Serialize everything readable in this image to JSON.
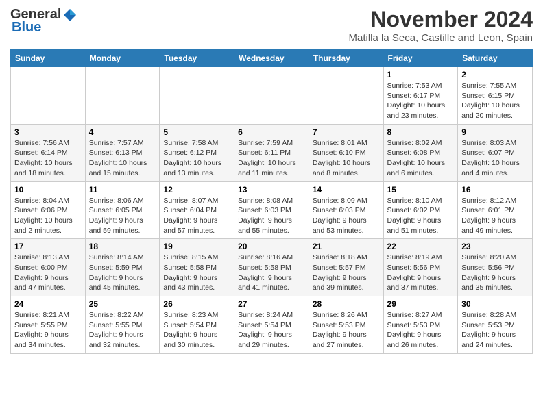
{
  "header": {
    "logo_general": "General",
    "logo_blue": "Blue",
    "month": "November 2024",
    "location": "Matilla la Seca, Castille and Leon, Spain"
  },
  "days_of_week": [
    "Sunday",
    "Monday",
    "Tuesday",
    "Wednesday",
    "Thursday",
    "Friday",
    "Saturday"
  ],
  "weeks": [
    [
      {
        "day": "",
        "info": ""
      },
      {
        "day": "",
        "info": ""
      },
      {
        "day": "",
        "info": ""
      },
      {
        "day": "",
        "info": ""
      },
      {
        "day": "",
        "info": ""
      },
      {
        "day": "1",
        "info": "Sunrise: 7:53 AM\nSunset: 6:17 PM\nDaylight: 10 hours and 23 minutes."
      },
      {
        "day": "2",
        "info": "Sunrise: 7:55 AM\nSunset: 6:15 PM\nDaylight: 10 hours and 20 minutes."
      }
    ],
    [
      {
        "day": "3",
        "info": "Sunrise: 7:56 AM\nSunset: 6:14 PM\nDaylight: 10 hours and 18 minutes."
      },
      {
        "day": "4",
        "info": "Sunrise: 7:57 AM\nSunset: 6:13 PM\nDaylight: 10 hours and 15 minutes."
      },
      {
        "day": "5",
        "info": "Sunrise: 7:58 AM\nSunset: 6:12 PM\nDaylight: 10 hours and 13 minutes."
      },
      {
        "day": "6",
        "info": "Sunrise: 7:59 AM\nSunset: 6:11 PM\nDaylight: 10 hours and 11 minutes."
      },
      {
        "day": "7",
        "info": "Sunrise: 8:01 AM\nSunset: 6:10 PM\nDaylight: 10 hours and 8 minutes."
      },
      {
        "day": "8",
        "info": "Sunrise: 8:02 AM\nSunset: 6:08 PM\nDaylight: 10 hours and 6 minutes."
      },
      {
        "day": "9",
        "info": "Sunrise: 8:03 AM\nSunset: 6:07 PM\nDaylight: 10 hours and 4 minutes."
      }
    ],
    [
      {
        "day": "10",
        "info": "Sunrise: 8:04 AM\nSunset: 6:06 PM\nDaylight: 10 hours and 2 minutes."
      },
      {
        "day": "11",
        "info": "Sunrise: 8:06 AM\nSunset: 6:05 PM\nDaylight: 9 hours and 59 minutes."
      },
      {
        "day": "12",
        "info": "Sunrise: 8:07 AM\nSunset: 6:04 PM\nDaylight: 9 hours and 57 minutes."
      },
      {
        "day": "13",
        "info": "Sunrise: 8:08 AM\nSunset: 6:03 PM\nDaylight: 9 hours and 55 minutes."
      },
      {
        "day": "14",
        "info": "Sunrise: 8:09 AM\nSunset: 6:03 PM\nDaylight: 9 hours and 53 minutes."
      },
      {
        "day": "15",
        "info": "Sunrise: 8:10 AM\nSunset: 6:02 PM\nDaylight: 9 hours and 51 minutes."
      },
      {
        "day": "16",
        "info": "Sunrise: 8:12 AM\nSunset: 6:01 PM\nDaylight: 9 hours and 49 minutes."
      }
    ],
    [
      {
        "day": "17",
        "info": "Sunrise: 8:13 AM\nSunset: 6:00 PM\nDaylight: 9 hours and 47 minutes."
      },
      {
        "day": "18",
        "info": "Sunrise: 8:14 AM\nSunset: 5:59 PM\nDaylight: 9 hours and 45 minutes."
      },
      {
        "day": "19",
        "info": "Sunrise: 8:15 AM\nSunset: 5:58 PM\nDaylight: 9 hours and 43 minutes."
      },
      {
        "day": "20",
        "info": "Sunrise: 8:16 AM\nSunset: 5:58 PM\nDaylight: 9 hours and 41 minutes."
      },
      {
        "day": "21",
        "info": "Sunrise: 8:18 AM\nSunset: 5:57 PM\nDaylight: 9 hours and 39 minutes."
      },
      {
        "day": "22",
        "info": "Sunrise: 8:19 AM\nSunset: 5:56 PM\nDaylight: 9 hours and 37 minutes."
      },
      {
        "day": "23",
        "info": "Sunrise: 8:20 AM\nSunset: 5:56 PM\nDaylight: 9 hours and 35 minutes."
      }
    ],
    [
      {
        "day": "24",
        "info": "Sunrise: 8:21 AM\nSunset: 5:55 PM\nDaylight: 9 hours and 34 minutes."
      },
      {
        "day": "25",
        "info": "Sunrise: 8:22 AM\nSunset: 5:55 PM\nDaylight: 9 hours and 32 minutes."
      },
      {
        "day": "26",
        "info": "Sunrise: 8:23 AM\nSunset: 5:54 PM\nDaylight: 9 hours and 30 minutes."
      },
      {
        "day": "27",
        "info": "Sunrise: 8:24 AM\nSunset: 5:54 PM\nDaylight: 9 hours and 29 minutes."
      },
      {
        "day": "28",
        "info": "Sunrise: 8:26 AM\nSunset: 5:53 PM\nDaylight: 9 hours and 27 minutes."
      },
      {
        "day": "29",
        "info": "Sunrise: 8:27 AM\nSunset: 5:53 PM\nDaylight: 9 hours and 26 minutes."
      },
      {
        "day": "30",
        "info": "Sunrise: 8:28 AM\nSunset: 5:53 PM\nDaylight: 9 hours and 24 minutes."
      }
    ]
  ]
}
